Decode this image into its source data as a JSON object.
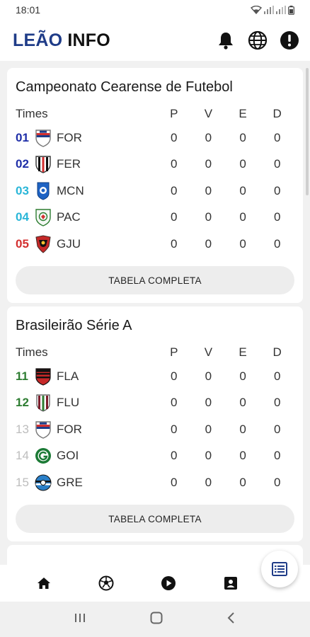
{
  "status_bar": {
    "time": "18:01"
  },
  "app": {
    "title_part1": "LEÃO",
    "title_part2": "INFO",
    "accent": "#1f3c88"
  },
  "tables": [
    {
      "title": "Campeonato Cearense de Futebol",
      "headers": {
        "team": "Times",
        "p": "P",
        "v": "V",
        "e": "E",
        "d": "D"
      },
      "rows": [
        {
          "pos": "01",
          "abbr": "FOR",
          "p": "0",
          "v": "0",
          "e": "0",
          "d": "0",
          "pos_color": "#1f2fa8",
          "crest": "fortaleza-crest-icon"
        },
        {
          "pos": "02",
          "abbr": "FER",
          "p": "0",
          "v": "0",
          "e": "0",
          "d": "0",
          "pos_color": "#1f2fa8",
          "crest": "ferroviario-crest-icon"
        },
        {
          "pos": "03",
          "abbr": "MCN",
          "p": "0",
          "v": "0",
          "e": "0",
          "d": "0",
          "pos_color": "#29b6d8",
          "crest": "maracana-crest-icon"
        },
        {
          "pos": "04",
          "abbr": "PAC",
          "p": "0",
          "v": "0",
          "e": "0",
          "d": "0",
          "pos_color": "#29b6d8",
          "crest": "pacajus-crest-icon"
        },
        {
          "pos": "05",
          "abbr": "GJU",
          "p": "0",
          "v": "0",
          "e": "0",
          "d": "0",
          "pos_color": "#d32f2f",
          "crest": "guarany-crest-icon"
        }
      ],
      "button": "TABELA COMPLETA"
    },
    {
      "title": "Brasileirão Série A",
      "headers": {
        "team": "Times",
        "p": "P",
        "v": "V",
        "e": "E",
        "d": "D"
      },
      "rows": [
        {
          "pos": "11",
          "abbr": "FLA",
          "p": "0",
          "v": "0",
          "e": "0",
          "d": "0",
          "pos_color": "#2e7d32",
          "crest": "flamengo-crest-icon"
        },
        {
          "pos": "12",
          "abbr": "FLU",
          "p": "0",
          "v": "0",
          "e": "0",
          "d": "0",
          "pos_color": "#2e7d32",
          "crest": "fluminense-crest-icon"
        },
        {
          "pos": "13",
          "abbr": "FOR",
          "p": "0",
          "v": "0",
          "e": "0",
          "d": "0",
          "pos_color": "#bdbdbd",
          "crest": "fortaleza-crest-icon"
        },
        {
          "pos": "14",
          "abbr": "GOI",
          "p": "0",
          "v": "0",
          "e": "0",
          "d": "0",
          "pos_color": "#bdbdbd",
          "crest": "goias-crest-icon"
        },
        {
          "pos": "15",
          "abbr": "GRE",
          "p": "0",
          "v": "0",
          "e": "0",
          "d": "0",
          "pos_color": "#bdbdbd",
          "crest": "gremio-crest-icon"
        }
      ],
      "button": "TABELA COMPLETA"
    }
  ],
  "bottom_nav": {
    "items": [
      {
        "icon": "home-icon"
      },
      {
        "icon": "soccer-ball-icon"
      },
      {
        "icon": "play-circle-icon"
      },
      {
        "icon": "contact-card-icon"
      }
    ],
    "fab_icon": "table-list-icon"
  }
}
